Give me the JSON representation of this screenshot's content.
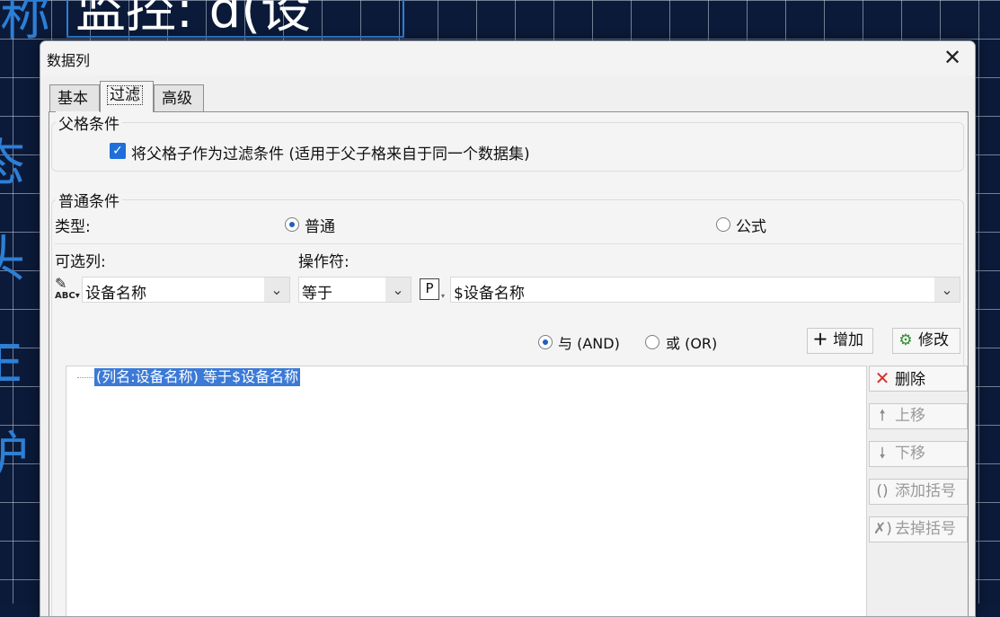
{
  "background": {
    "title_text": "监控: d(设",
    "left_glyphs": [
      "称",
      "态",
      "头",
      "E",
      "护"
    ]
  },
  "dialog": {
    "title": "数据列",
    "close_glyph": "✕",
    "tabs": [
      {
        "label": "基本",
        "active": false
      },
      {
        "label": "过滤",
        "active": true
      },
      {
        "label": "高级",
        "active": false
      }
    ],
    "parent_condition": {
      "legend": "父格条件",
      "checkbox_label": "将父格子作为过滤条件 (适用于父子格来自于同一个数据集)",
      "checked": true
    },
    "normal_condition": {
      "legend": "普通条件",
      "type_label": "类型:",
      "type_options": [
        {
          "label": "普通",
          "selected": true
        },
        {
          "label": "公式",
          "selected": false
        }
      ],
      "column_label": "可选列:",
      "operator_label": "操作符:",
      "column_value": "设备名称",
      "operator_value": "等于",
      "param_icon_text": "P",
      "param_value": "$设备名称",
      "logic_and": "与 (AND)",
      "logic_or": "或 (OR)",
      "logic_selected": "and",
      "add_button": "增加",
      "modify_button": "修改",
      "condition_item": "(列名:设备名称) 等于$设备名称",
      "delete_button": "删除",
      "move_up_button": "上移",
      "move_down_button": "下移",
      "add_bracket_button": "添加括号",
      "remove_bracket_button": "去掉括号"
    }
  },
  "colors": {
    "accent": "#1e6fd9",
    "selection": "#3b7ad6",
    "delete_icon": "#d9302c",
    "background": "#0b1a39"
  }
}
